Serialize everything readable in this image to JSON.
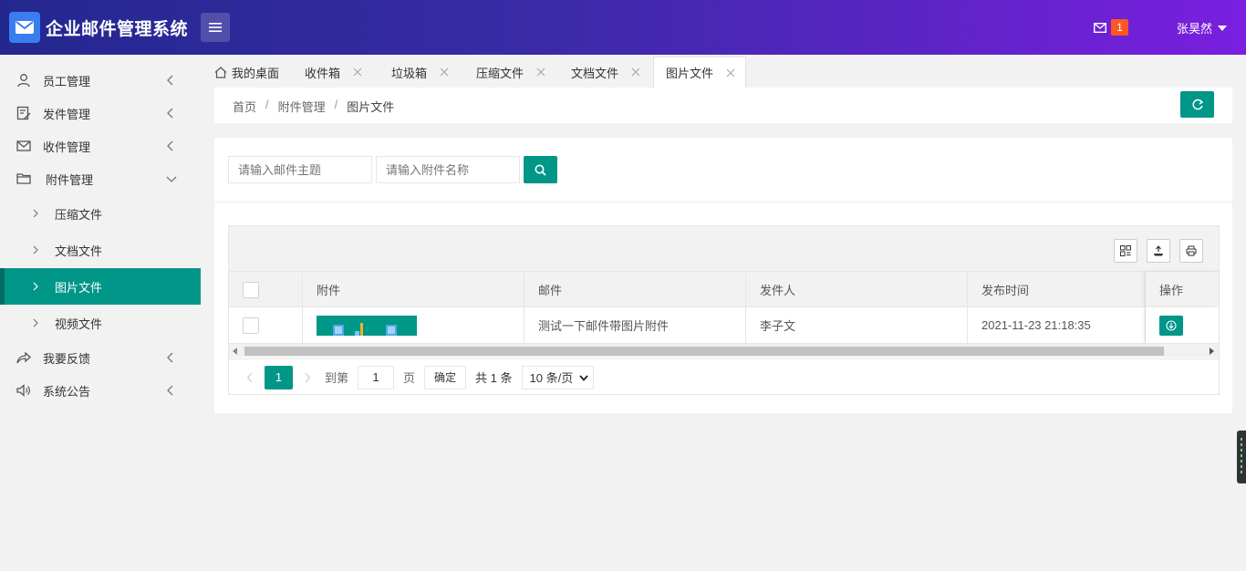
{
  "app": {
    "title": "企业邮件管理系统"
  },
  "header": {
    "mail_count": "1",
    "user_name": "张昊然"
  },
  "sidebar": {
    "items": [
      {
        "label": "员工管理"
      },
      {
        "label": "发件管理"
      },
      {
        "label": "收件管理"
      },
      {
        "label": "附件管理"
      },
      {
        "label": "我要反馈"
      },
      {
        "label": "系统公告"
      }
    ],
    "sub_items": [
      {
        "label": "压缩文件"
      },
      {
        "label": "文档文件"
      },
      {
        "label": "图片文件"
      },
      {
        "label": "视频文件"
      }
    ]
  },
  "tabs": [
    {
      "label": "我的桌面"
    },
    {
      "label": "收件箱"
    },
    {
      "label": "垃圾箱"
    },
    {
      "label": "压缩文件"
    },
    {
      "label": "文档文件"
    },
    {
      "label": "图片文件"
    }
  ],
  "breadcrumb": {
    "home": "首页",
    "section": "附件管理",
    "current": "图片文件",
    "separator": "/"
  },
  "search": {
    "subject_placeholder": "请输入邮件主题",
    "attachment_placeholder": "请输入附件名称"
  },
  "table": {
    "columns": [
      "附件",
      "邮件",
      "发件人",
      "发布时间",
      "操作"
    ],
    "rows": [
      {
        "mail": "测试一下邮件带图片附件",
        "sender": "李子文",
        "time": "2021-11-23 21:18:35"
      }
    ]
  },
  "pagination": {
    "current_page": "1",
    "goto_label": "到第",
    "goto_value": "1",
    "page_unit": "页",
    "confirm": "确定",
    "total": "共 1 条",
    "page_size": "10 条/页"
  },
  "colors": {
    "accent": "#009688",
    "header_start": "#23288f",
    "header_end": "#7a1fe0",
    "badge": "#ff5722"
  }
}
